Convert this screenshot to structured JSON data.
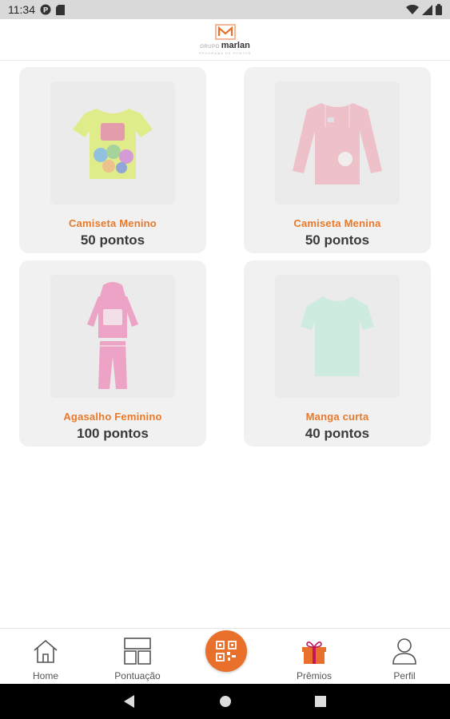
{
  "status_bar": {
    "time": "11:34",
    "icons": [
      "p-icon",
      "sd-card-icon",
      "wifi-icon",
      "signal-icon",
      "battery-icon"
    ]
  },
  "header": {
    "logo_pre": "GRUPO",
    "logo_main": "marlan",
    "logo_sub": "PROGRAMA DE PONTOS",
    "brand_color": "#e8702a"
  },
  "products": [
    {
      "name": "Camiseta Menino",
      "points": "50 pontos",
      "image": "boys-tshirt-icon"
    },
    {
      "name": "Camiseta Menina",
      "points": "50 pontos",
      "image": "girls-longsleeve-icon"
    },
    {
      "name": "Agasalho Feminino",
      "points": "100 pontos",
      "image": "girls-tracksuit-icon"
    },
    {
      "name": "Manga curta",
      "points": "40 pontos",
      "image": "short-sleeve-icon"
    }
  ],
  "bottom_nav": {
    "home": "Home",
    "pontuacao": "Pontuação",
    "scan": "qr-code-icon",
    "premios": "Prêmios",
    "perfil": "Perfil",
    "active_color": "#e8702a"
  }
}
